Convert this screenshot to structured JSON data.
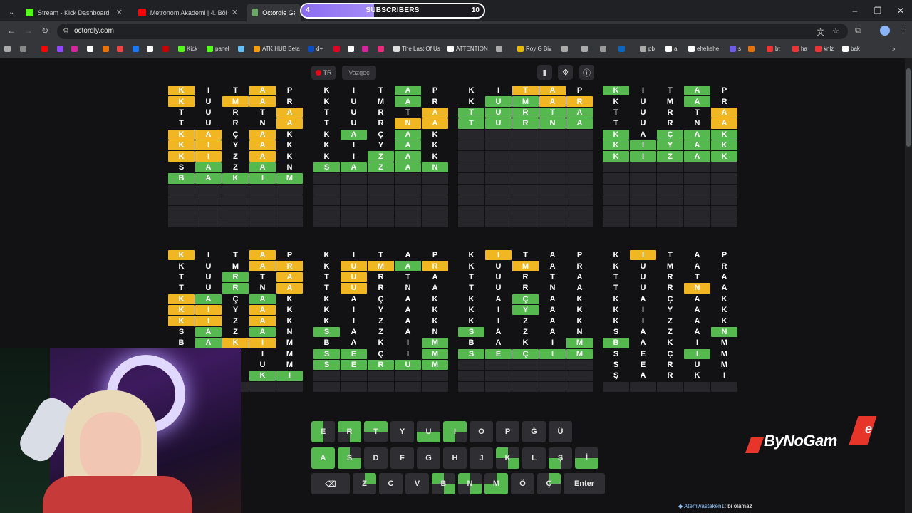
{
  "browser": {
    "tabs": [
      {
        "title": "Stream - Kick Dashboard",
        "icon": "kick-icon",
        "color": "#53fc18"
      },
      {
        "title": "Metronom Akademi | 4. Bölüm",
        "icon": "youtube-icon",
        "color": "#ff0000"
      },
      {
        "title": "Octordle Game",
        "icon": "octordle-icon",
        "color": "#6aaa64"
      }
    ],
    "url": "octordly.com",
    "bookmarks": [
      "Kick",
      "panel",
      "ATK HUB Beta",
      "d+",
      "The Last Of Us",
      "ATTENTION",
      "Roy G Biv",
      "al",
      "pb",
      "ehehehe",
      "s",
      "bt",
      "ha",
      "knlz",
      "bak"
    ]
  },
  "subscriber_goal": {
    "label": "SUBSCRIBERS",
    "current": "4",
    "goal": "10",
    "progress": 0.4
  },
  "game": {
    "lang_label": "TR",
    "giveup_label": "Vazgeç",
    "colors": {
      "green": "#55b94f",
      "yellow": "#f0b722",
      "empty": "#26262b"
    },
    "boards": [
      {
        "rows": [
          {
            "l": "KITAP",
            "s": "yxxyx"
          },
          {
            "l": "KUMAR",
            "s": "yxyyx"
          },
          {
            "l": "TURTA",
            "s": "xxxxy"
          },
          {
            "l": "TURNA",
            "s": "xxxxy"
          },
          {
            "l": "KAÇAK",
            "s": "yyxyx"
          },
          {
            "l": "KIYAK",
            "s": "yyxyx"
          },
          {
            "l": "KIZAK",
            "s": "yyxyx"
          },
          {
            "l": "SAZAN",
            "s": "xgxgx"
          },
          {
            "l": "BAKIM",
            "s": "ggggg"
          }
        ]
      },
      {
        "rows": [
          {
            "l": "KITAP",
            "s": "xxxgx"
          },
          {
            "l": "KUMAR",
            "s": "xxxgx"
          },
          {
            "l": "TURTA",
            "s": "xxxxy"
          },
          {
            "l": "TURNA",
            "s": "xxxyy"
          },
          {
            "l": "KAÇAK",
            "s": "xgxgx"
          },
          {
            "l": "KIYAK",
            "s": "xxxgx"
          },
          {
            "l": "KIZAK",
            "s": "xxggx"
          },
          {
            "l": "SAZAN",
            "s": "ggggg"
          }
        ]
      },
      {
        "rows": [
          {
            "l": "KITAP",
            "s": "xxyyx"
          },
          {
            "l": "KUMAR",
            "s": "xggyy"
          },
          {
            "l": "TURTA",
            "s": "ggggg"
          },
          {
            "l": "TURNA",
            "s": "ggggg"
          }
        ]
      },
      {
        "rows": [
          {
            "l": "KITAP",
            "s": "gxxgx"
          },
          {
            "l": "KUMAR",
            "s": "xxxgx"
          },
          {
            "l": "TURTA",
            "s": "xxxxy"
          },
          {
            "l": "TURNA",
            "s": "xxxxy"
          },
          {
            "l": "KAÇAK",
            "s": "gxggg"
          },
          {
            "l": "KIYAK",
            "s": "ggggg"
          },
          {
            "l": "KIZAK",
            "s": "ggggg"
          }
        ]
      },
      {
        "rows": [
          {
            "l": "KITAP",
            "s": "yxxyx"
          },
          {
            "l": "KUMAR",
            "s": "xxxyy"
          },
          {
            "l": "TURTA",
            "s": "xxgxy"
          },
          {
            "l": "TURNA",
            "s": "xxgxy"
          },
          {
            "l": "KAÇAK",
            "s": "ygxgx"
          },
          {
            "l": "KIYAK",
            "s": "yyxyx"
          },
          {
            "l": "KIZAK",
            "s": "yyxyx"
          },
          {
            "l": "SAZAN",
            "s": "xgxgx"
          },
          {
            "l": "BAKIM",
            "s": "xgyyx"
          },
          {
            "l": "SEÇIM",
            "s": "xxxxx"
          },
          {
            "l": "SERUM",
            "s": "xxxxx"
          },
          {
            "l": "ŞARKI",
            "s": "xxxgg"
          }
        ]
      },
      {
        "rows": [
          {
            "l": "KITAP",
            "s": "xxxxx"
          },
          {
            "l": "KUMAR",
            "s": "xyygy"
          },
          {
            "l": "TURTA",
            "s": "xyxxx"
          },
          {
            "l": "TURNA",
            "s": "xyxxx"
          },
          {
            "l": "KAÇAK",
            "s": "xxxxx"
          },
          {
            "l": "KIYAK",
            "s": "xxxxx"
          },
          {
            "l": "KIZAK",
            "s": "xxxxx"
          },
          {
            "l": "SAZAN",
            "s": "gxxxx"
          },
          {
            "l": "BAKIM",
            "s": "xxxxg"
          },
          {
            "l": "SEÇIM",
            "s": "ggxxg"
          },
          {
            "l": "SERUM",
            "s": "ggggg"
          }
        ]
      },
      {
        "rows": [
          {
            "l": "KITAP",
            "s": "xyxxx"
          },
          {
            "l": "KUMAR",
            "s": "xxyxx"
          },
          {
            "l": "TURTA",
            "s": "xxxxx"
          },
          {
            "l": "TURNA",
            "s": "xxxxx"
          },
          {
            "l": "KAÇAK",
            "s": "xxgxx"
          },
          {
            "l": "KIYAK",
            "s": "xxgxx"
          },
          {
            "l": "KIZAK",
            "s": "xxxxx"
          },
          {
            "l": "SAZAN",
            "s": "gxxxx"
          },
          {
            "l": "BAKIM",
            "s": "xxxxg"
          },
          {
            "l": "SEÇIM",
            "s": "ggggg"
          }
        ]
      },
      {
        "rows": [
          {
            "l": "KITAP",
            "s": "xyxxx"
          },
          {
            "l": "KUMAR",
            "s": "xxxxx"
          },
          {
            "l": "TURTA",
            "s": "xxxxx"
          },
          {
            "l": "TURNA",
            "s": "xxxyx"
          },
          {
            "l": "KAÇAK",
            "s": "xxxxx"
          },
          {
            "l": "KIYAK",
            "s": "xxxxx"
          },
          {
            "l": "KIZAK",
            "s": "xxxxx"
          },
          {
            "l": "SAZAN",
            "s": "xxxxg"
          },
          {
            "l": "BAKIM",
            "s": "gxxxx"
          },
          {
            "l": "SEÇIM",
            "s": "xxxgx"
          },
          {
            "l": "SERUM",
            "s": "xxxxx"
          },
          {
            "l": "ŞARKI",
            "s": "xxxxx"
          }
        ]
      }
    ],
    "keyboard": {
      "row1": [
        {
          "k": "E",
          "q": "g.x.g.x"
        },
        {
          "k": "R",
          "q": "g.g.x.g"
        },
        {
          "k": "T",
          "q": "g.g.x.x"
        },
        {
          "k": "Y",
          "q": ""
        },
        {
          "k": "U",
          "q": "x.x.g.g"
        },
        {
          "k": "I",
          "q": "g.g.g.x"
        },
        {
          "k": "O",
          "q": ""
        },
        {
          "k": "P",
          "q": ""
        },
        {
          "k": "Ğ",
          "q": ""
        },
        {
          "k": "Ü",
          "q": ""
        }
      ],
      "row2": [
        {
          "k": "A",
          "q": "g.g.g.g"
        },
        {
          "k": "S",
          "q": "g.x.g.g"
        },
        {
          "k": "D",
          "q": ""
        },
        {
          "k": "F",
          "q": ""
        },
        {
          "k": "G",
          "q": ""
        },
        {
          "k": "H",
          "q": ""
        },
        {
          "k": "J",
          "q": ""
        },
        {
          "k": "K",
          "q": "g.x.x.g"
        },
        {
          "k": "L",
          "q": ""
        },
        {
          "k": "Ş",
          "q": "x.x.g.x"
        },
        {
          "k": "İ",
          "q": "x.x.g.g"
        }
      ],
      "row3": [
        {
          "k": "Z",
          "q": "x.g.x.x"
        },
        {
          "k": "C",
          "q": ""
        },
        {
          "k": "V",
          "q": ""
        },
        {
          "k": "B",
          "q": "g.x.x.g"
        },
        {
          "k": "N",
          "q": "g.x.x.g"
        },
        {
          "k": "M",
          "q": "x.g.g.g"
        },
        {
          "k": "Ö",
          "q": ""
        },
        {
          "k": "Ç",
          "q": "x.g.x.x"
        }
      ],
      "enter_label": "Enter",
      "backspace_icon": "backspace-icon"
    }
  },
  "overlay": {
    "brand": "ByNoGam",
    "brand_e": "e",
    "chat_user": "Atemwastaken1",
    "chat_message": ": bi olamaz"
  }
}
